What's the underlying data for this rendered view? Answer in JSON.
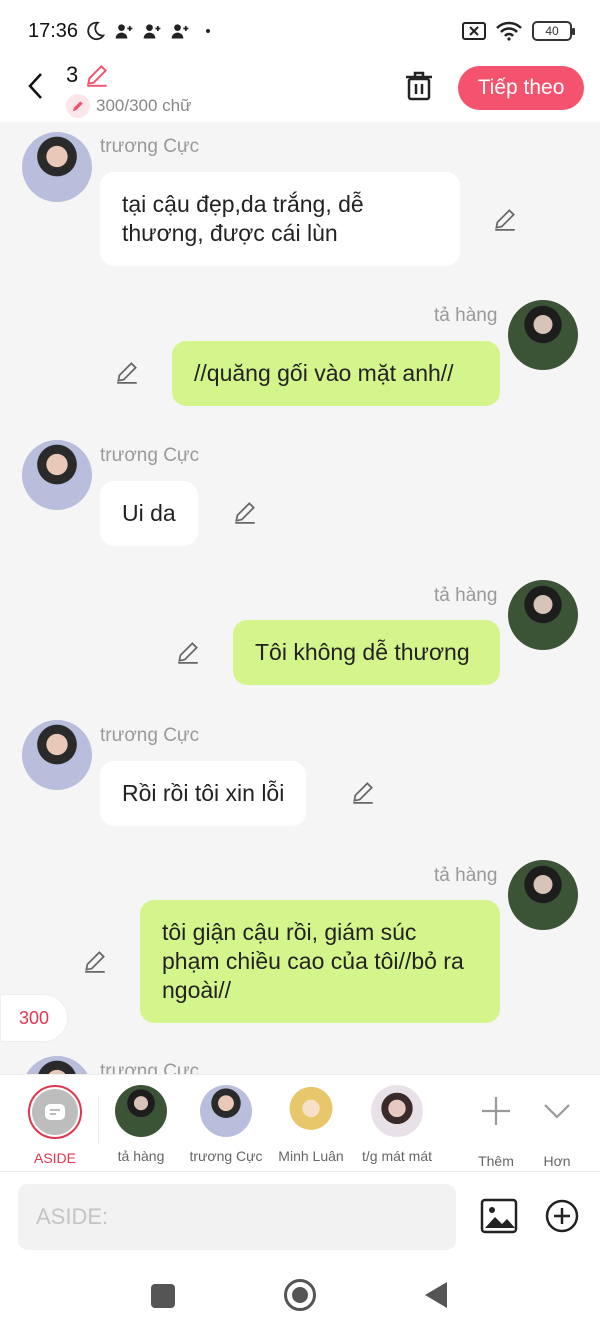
{
  "status_bar": {
    "time": "17:36",
    "battery": "40"
  },
  "header": {
    "title": "3",
    "char_count": "300/300 chữ",
    "next_label": "Tiếp theo"
  },
  "messages": [
    {
      "side": "left",
      "sender": "trương Cực",
      "text": "tại cậu đẹp,da trắng, dễ thương, được cái lùn"
    },
    {
      "side": "right",
      "sender": "tả hàng",
      "text": "//quăng gối vào mặt anh//"
    },
    {
      "side": "left",
      "sender": "trương Cực",
      "text": "Ui da"
    },
    {
      "side": "right",
      "sender": "tả hàng",
      "text": "Tôi không dễ thương"
    },
    {
      "side": "left",
      "sender": "trương Cực",
      "text": "Rồi rồi tôi xin lỗi"
    },
    {
      "side": "right",
      "sender": "tả hàng",
      "text": "tôi giận cậu rồi, giám súc phạm chiều cao của tôi//bỏ ra ngoài//"
    },
    {
      "side": "left",
      "sender": "trương Cực",
      "text": ""
    }
  ],
  "counter_chip": "300",
  "characters": [
    {
      "name": "ASIDE",
      "icon": "aside-chat-icon"
    },
    {
      "name": "tả hàng"
    },
    {
      "name": "trương Cực"
    },
    {
      "name": "Minh Luân"
    },
    {
      "name": "t/g mát mát"
    },
    {
      "name": "Thêm",
      "icon": "plus-icon"
    },
    {
      "name": "Hơn",
      "icon": "chevron-down-icon"
    }
  ],
  "input": {
    "placeholder": "ASIDE:",
    "value": ""
  },
  "colors": {
    "accent": "#f5526e",
    "bubble_right": "#d4f58c",
    "bubble_left": "#ffffff",
    "background": "#f5f5f5"
  }
}
